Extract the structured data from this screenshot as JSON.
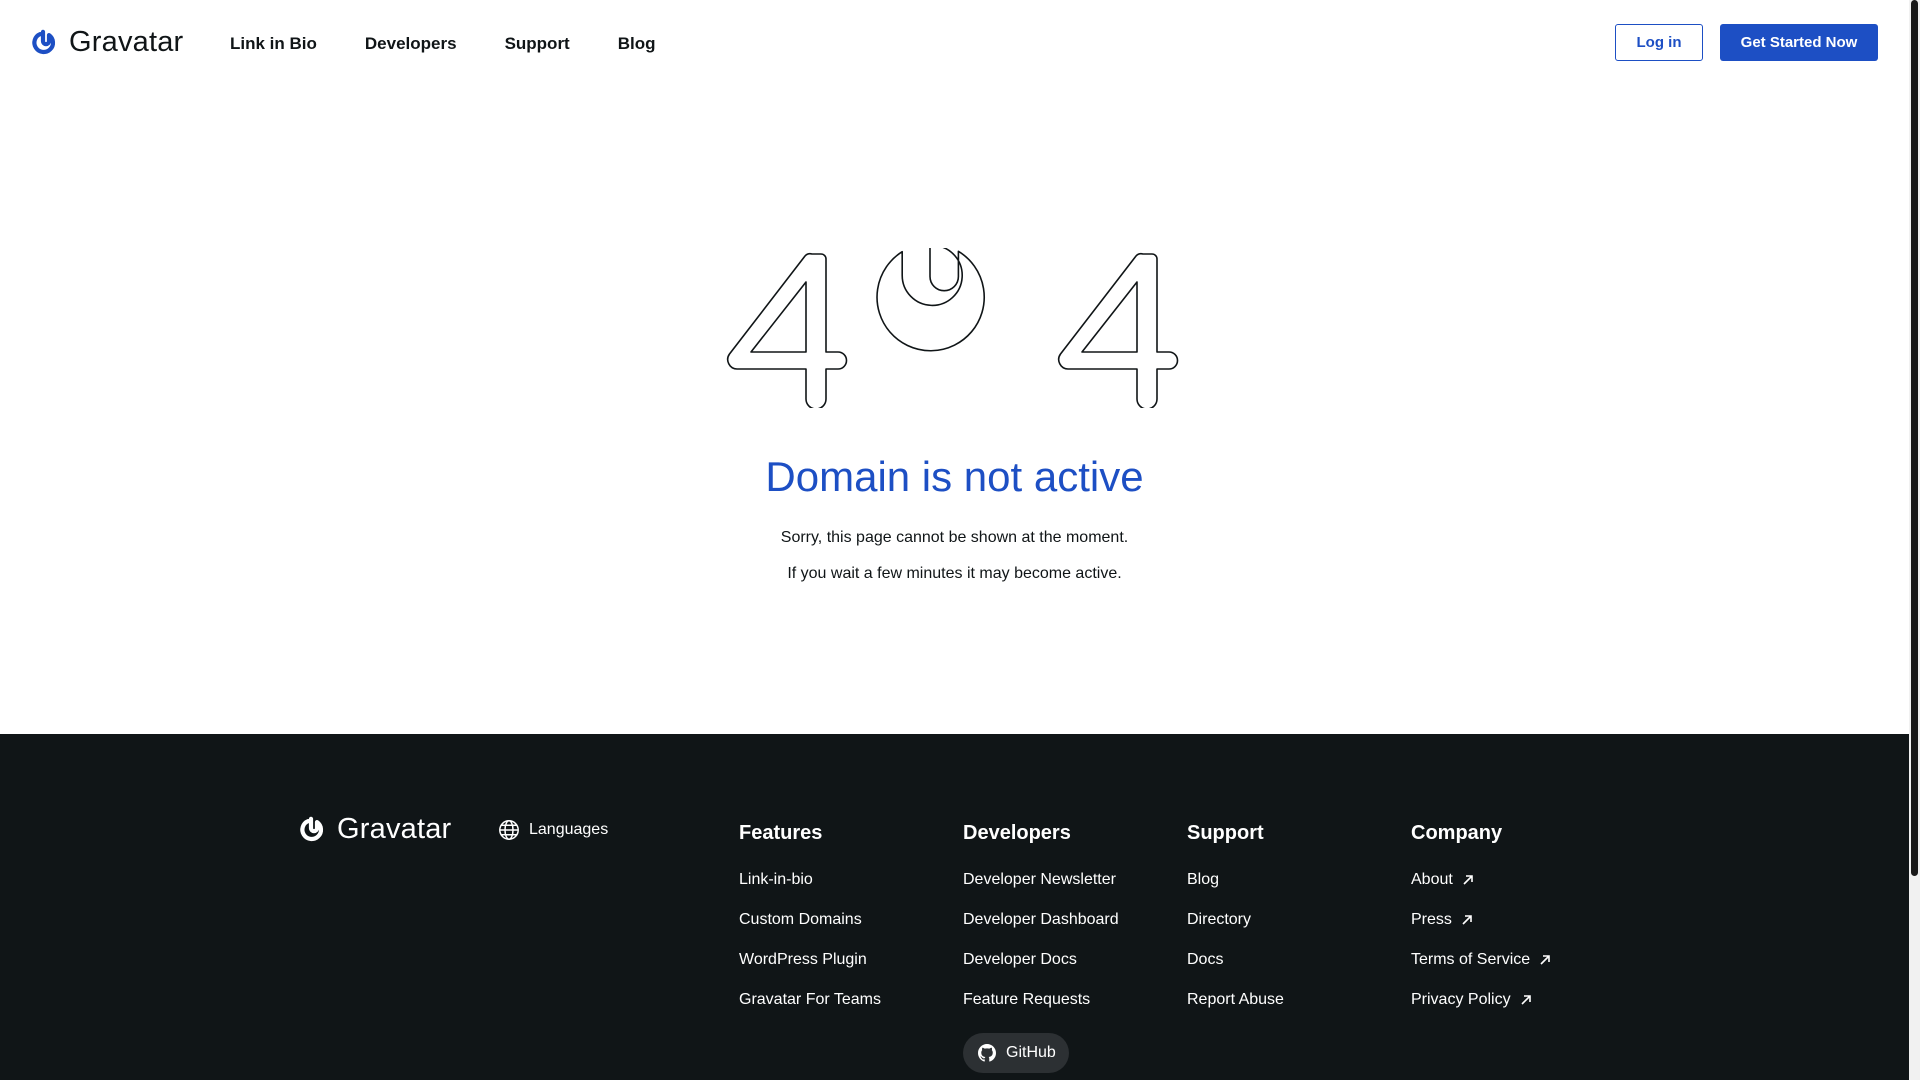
{
  "header": {
    "brand": "Gravatar",
    "nav": [
      "Link in Bio",
      "Developers",
      "Support",
      "Blog"
    ],
    "login_label": "Log in",
    "cta_label": "Get Started Now"
  },
  "main": {
    "code": "404",
    "headline": "Domain is not active",
    "message_1": "Sorry, this page cannot be shown at the moment.",
    "message_2": "If you wait a few minutes it may become active."
  },
  "footer": {
    "brand": "Gravatar",
    "languages_label": "Languages",
    "columns": [
      {
        "title": "Features",
        "links": [
          "Link-in-bio",
          "Custom Domains",
          "WordPress Plugin",
          "Gravatar For Teams"
        ]
      },
      {
        "title": "Developers",
        "links": [
          "Developer Newsletter",
          "Developer Dashboard",
          "Developer Docs",
          "Feature Requests"
        ]
      },
      {
        "title": "Support",
        "links": [
          "Blog",
          "Directory",
          "Docs",
          "Report Abuse"
        ]
      },
      {
        "title": "Company",
        "links": [
          "About",
          "Press",
          "Terms of Service",
          "Privacy Policy"
        ]
      }
    ],
    "github_label": "GitHub"
  },
  "colors": {
    "brand_blue": "#1d4fc4",
    "footer_bg": "#101517",
    "text_dark": "#101517",
    "github_pill": "#2c3033"
  },
  "icons": {
    "brand": "gravatar-logo-icon",
    "languages": "globe-icon",
    "external": "arrow-up-right-icon",
    "github": "github-icon"
  }
}
